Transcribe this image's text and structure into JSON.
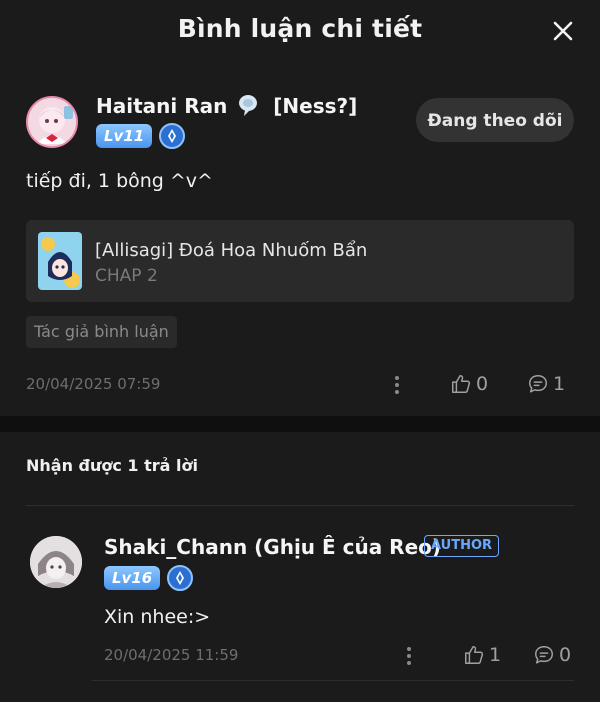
{
  "header": {
    "title": "Bình luận chi tiết",
    "close_icon": "close-icon"
  },
  "comment": {
    "user_name": "Haitani Ran",
    "user_tag": "[Ness?]",
    "level": "Lv11",
    "follow_label": "Đang theo dõi",
    "text": "tiếp đi,  1 bông ^v^",
    "chapter": {
      "title": "[Allisagi] Đoá Hoa Nhuốm Bẩn",
      "sub": "CHAP 2"
    },
    "author_tag": "Tác giả bình luận",
    "timestamp": "20/04/2025 07:59",
    "likes": "0",
    "replies": "1"
  },
  "replies_section": {
    "heading": "Nhận được 1 trả lời"
  },
  "reply": {
    "user_name": "Shaki_Chann (Ghịu Ê của Reo)",
    "author_badge": "AUTHOR",
    "level": "Lv16",
    "text": "Xin nhee:>",
    "timestamp": "20/04/2025 11:59",
    "likes": "1",
    "replies": "0"
  },
  "colors": {
    "background": "#121212",
    "card": "#1b1b1b",
    "level_badge": "#4a94ee",
    "author_badge": "#6aa8ff"
  }
}
